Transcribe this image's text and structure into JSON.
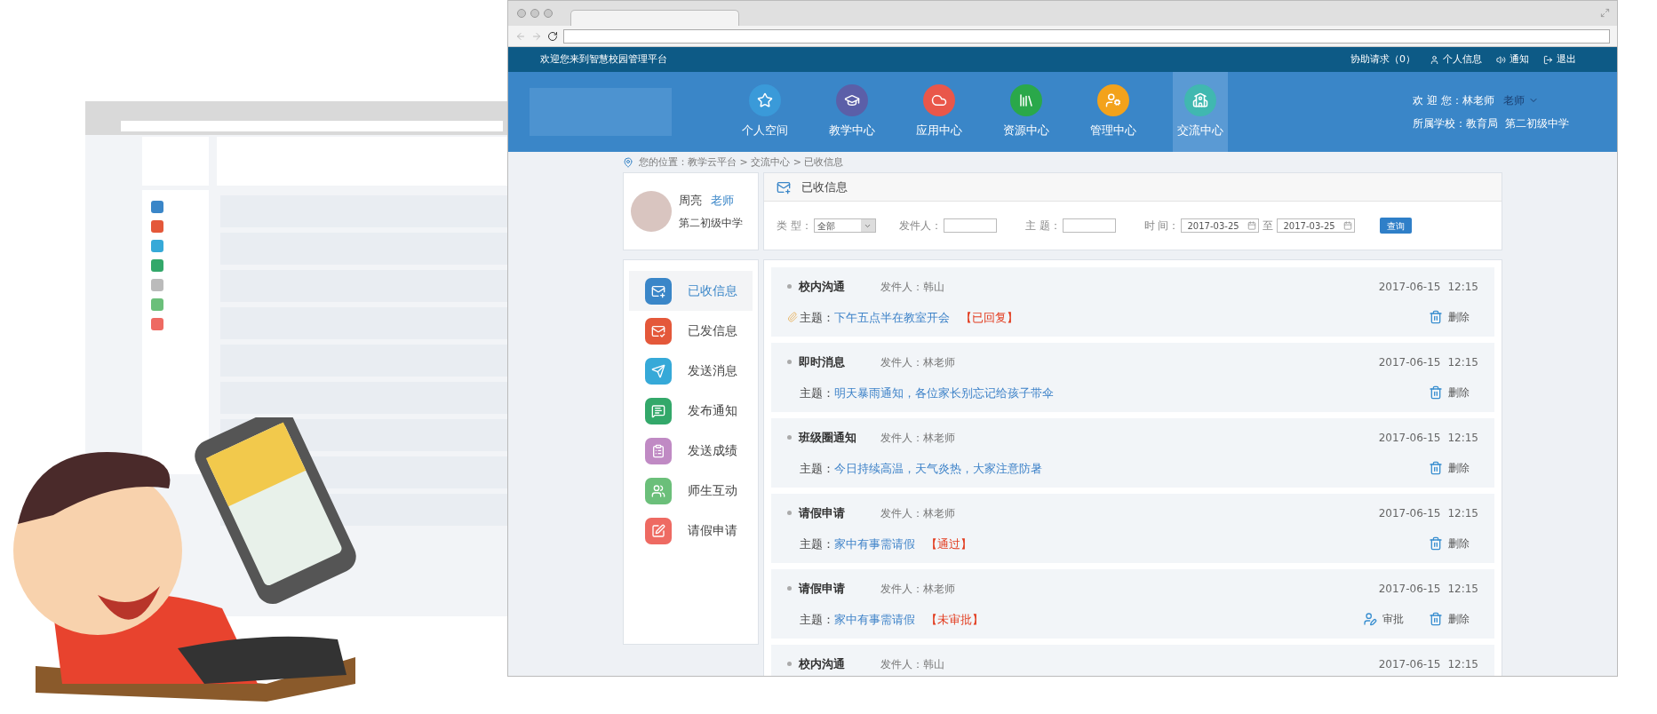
{
  "topbar": {
    "welcome": "欢迎您来到智慧校园管理平台",
    "links": [
      {
        "kind": "text",
        "label": "协助请求（0）"
      },
      {
        "kind": "user",
        "label": "个人信息"
      },
      {
        "kind": "sound",
        "label": "通知"
      },
      {
        "kind": "logout",
        "label": "退出"
      }
    ]
  },
  "nav": {
    "items": [
      {
        "label": "个人空间",
        "color": "#3a9ad9",
        "selected": false
      },
      {
        "label": "教学中心",
        "color": "#5b5fa8",
        "selected": false
      },
      {
        "label": "应用中心",
        "color": "#e9574a",
        "selected": false
      },
      {
        "label": "资源中心",
        "color": "#2aa84a",
        "selected": false
      },
      {
        "label": "管理中心",
        "color": "#f3a21b",
        "selected": false
      },
      {
        "label": "交流中心",
        "color": "#40b8b0",
        "selected": true
      }
    ],
    "user": {
      "greeting": "欢 迎 您：林老师",
      "role": "老师",
      "school_label": "所属学校：教育局",
      "school": "第二初级中学"
    }
  },
  "breadcrumb": "您的位置：教学云平台 > 交流中心 > 已收信息",
  "profile": {
    "name": "周亮",
    "role": "老师",
    "school": "第二初级中学"
  },
  "panel": {
    "title": "已收信息",
    "filters": {
      "type_label": "类 型：",
      "type_value": "全部",
      "sender_label": "发件人：",
      "subject_label": "主 题：",
      "time_label": "时 间：",
      "date_from": "2017-03-25",
      "to_label": "至",
      "date_to": "2017-03-25",
      "search_button": "查询"
    }
  },
  "sidebar": {
    "items": [
      {
        "label": "已收信息",
        "color": "#3a86c8",
        "selected": true
      },
      {
        "label": "已发信息",
        "color": "#e4583a",
        "selected": false
      },
      {
        "label": "发送消息",
        "color": "#36a9d8",
        "selected": false
      },
      {
        "label": "发布通知",
        "color": "#33a86a",
        "selected": false
      },
      {
        "label": "发送成绩",
        "color": "#c08ac4",
        "selected": false
      },
      {
        "label": "师生互动",
        "color": "#6bbf7a",
        "selected": false
      },
      {
        "label": "请假申请",
        "color": "#ee6a62",
        "selected": false
      }
    ]
  },
  "messages": [
    {
      "category": "校内沟通",
      "sender": "发件人：韩山",
      "date": "2017-06-15",
      "time": "12:15",
      "attachment": true,
      "subject_label": "主题：",
      "subject": "下午五点半在教室开会",
      "status": "【已回复】",
      "actions": [
        {
          "kind": "delete",
          "label": "删除"
        }
      ]
    },
    {
      "category": "即时消息",
      "sender": "发件人：林老师",
      "date": "2017-06-15",
      "time": "12:15",
      "attachment": false,
      "subject_label": "主题：",
      "subject": "明天暴雨通知，各位家长别忘记给孩子带伞",
      "actions": [
        {
          "kind": "delete",
          "label": "删除"
        }
      ]
    },
    {
      "category": "班级圈通知",
      "sender": "发件人：林老师",
      "date": "2017-06-15",
      "time": "12:15",
      "attachment": false,
      "subject_label": "主题：",
      "subject": "今日持续高温，天气炎热，大家注意防暑",
      "actions": [
        {
          "kind": "delete",
          "label": "删除"
        }
      ]
    },
    {
      "category": "请假申请",
      "sender": "发件人：林老师",
      "date": "2017-06-15",
      "time": "12:15",
      "attachment": false,
      "subject_label": "主题：",
      "subject": "家中有事需请假",
      "status": "【通过】",
      "actions": [
        {
          "kind": "delete",
          "label": "删除"
        }
      ]
    },
    {
      "category": "请假申请",
      "sender": "发件人：林老师",
      "date": "2017-06-15",
      "time": "12:15",
      "attachment": false,
      "subject_label": "主题：",
      "subject": "家中有事需请假",
      "status": "【未审批】",
      "actions": [
        {
          "kind": "approve",
          "label": "审批"
        },
        {
          "kind": "delete",
          "label": "删除"
        }
      ]
    },
    {
      "category": "校内沟通",
      "sender": "发件人：韩山",
      "date": "2017-06-15",
      "time": "12:15"
    }
  ]
}
